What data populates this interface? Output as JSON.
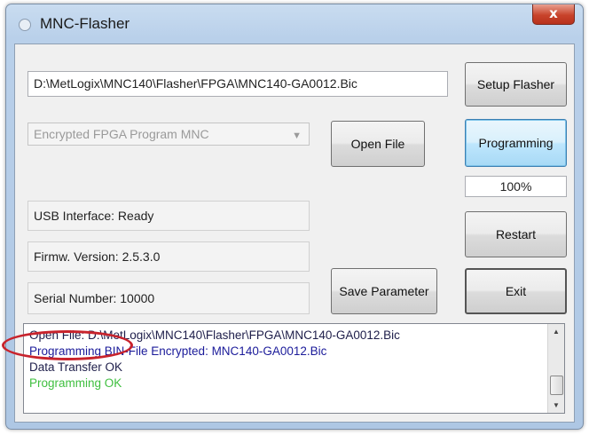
{
  "window": {
    "title": "MNC-Flasher",
    "close_label": "x"
  },
  "file_path": "D:\\MetLogix\\MNC140\\Flasher\\FPGA\\MNC140-GA0012.Bic",
  "program_type": {
    "selected": "Encrypted FPGA Program MNC"
  },
  "status": {
    "usb": "USB Interface: Ready",
    "firmware": "Firmw. Version: 2.5.3.0",
    "serial": "Serial Number: 10000"
  },
  "buttons": {
    "setup_flasher": "Setup Flasher",
    "open_file": "Open File",
    "programming": "Programming",
    "restart": "Restart",
    "save_parameter": "Save Parameter",
    "exit": "Exit"
  },
  "progress": {
    "label": "100%",
    "value": 100
  },
  "log": {
    "lines": [
      {
        "text": "Open File: D:\\MetLogix\\MNC140\\Flasher\\FPGA\\MNC140-GA0012.Bic",
        "color": "#1e1e4a"
      },
      {
        "text": "Programming BIN-File Encrypted: MNC140-GA0012.Bic",
        "color": "#1b1b9a"
      },
      {
        "text": "Data Transfer OK",
        "color": "#1e1e4a"
      },
      {
        "text": "Programming OK",
        "color": "#3fbf3f"
      }
    ]
  },
  "colors": {
    "highlight_ring": "#c8232c",
    "close_button": "#c8432b"
  }
}
